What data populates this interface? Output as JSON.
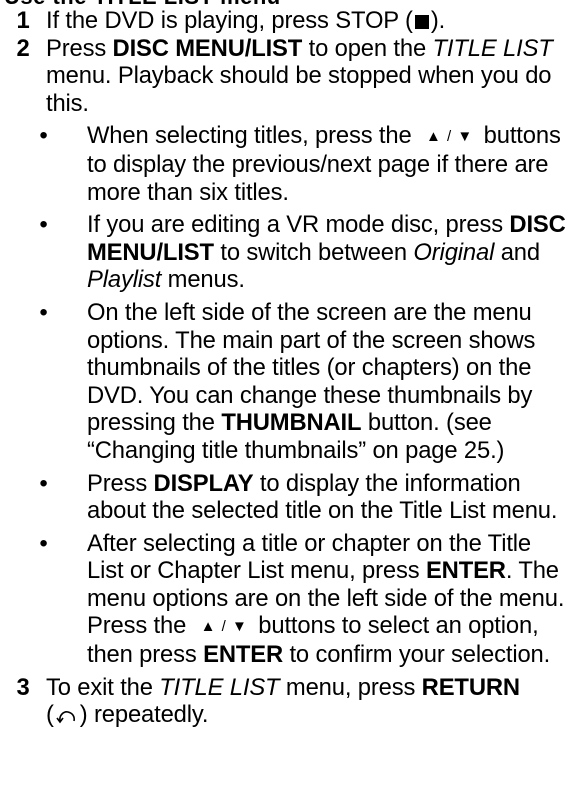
{
  "header_partial": "Use the TITLE LIST menu",
  "steps": [
    {
      "num": "1",
      "text_a": "If the DVD is playing, press STOP (",
      "icon": "stop-icon",
      "text_b": ")."
    },
    {
      "num": "2",
      "text_a": "Press ",
      "bold_a": "DISC MENU/LIST",
      "text_b": " to open the ",
      "italic_a": "TITLE LIST",
      "text_c": " menu. Playback should be stopped when you do this.",
      "bullets": [
        {
          "text_a": "When selecting titles, press the ",
          "arrows": "▲ / ▼",
          "text_b": " buttons to display the previous/next page if there are more than six titles."
        },
        {
          "text_a": "If you are editing a VR mode disc, press ",
          "bold_a": "DISC MENU/LIST",
          "text_b": " to switch between ",
          "italic_a": "Original",
          "text_c": " and ",
          "italic_b": "Playlist",
          "text_d": " menus."
        },
        {
          "text_a": "On the left side of the screen are the menu options. The main part of the screen shows thumbnails of the titles (or chapters) on the DVD. You can change these thumbnails by pressing the ",
          "bold_a": "THUMBNAIL",
          "text_b": " button. (see “Changing title thumbnails” on page 25.)"
        },
        {
          "text_a": "Press ",
          "bold_a": "DISPLAY",
          "text_b": " to display the information about the selected title on the Title List menu."
        },
        {
          "text_a": "After selecting a title or chapter on the Title List or Chapter List menu, press ",
          "bold_a": "ENTER",
          "text_b": ". The menu options are on the left side of the menu. Press the ",
          "arrows": "▲ / ▼",
          "text_c": " buttons to select an option, then press ",
          "bold_b": "ENTER",
          "text_d": " to confirm your selection."
        }
      ]
    },
    {
      "num": "3",
      "text_a": "To exit the ",
      "italic_a": "TITLE LIST",
      "text_b": " menu, press ",
      "bold_a": "RETURN",
      "text_c": "(",
      "icon": "return-icon",
      "text_d": ") repeatedly."
    }
  ]
}
